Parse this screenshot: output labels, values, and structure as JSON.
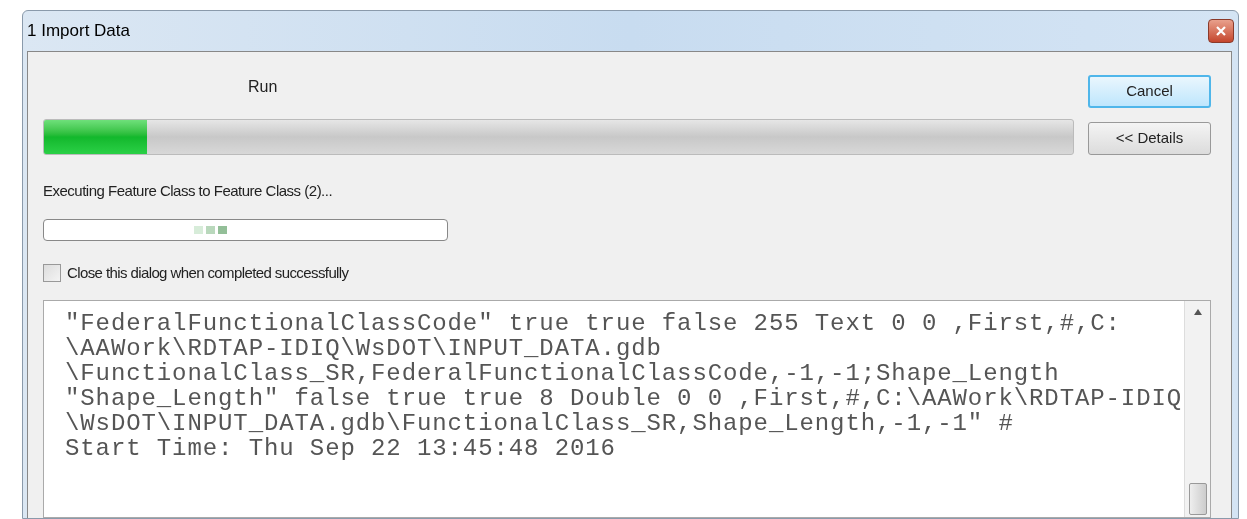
{
  "window": {
    "title": "1 Import Data"
  },
  "status": {
    "label": "Run",
    "level": 0.1
  },
  "buttons": [
    {
      "label": "Cancel",
      "focused": true
    },
    {
      "label": "<< Details",
      "focused": false
    }
  ],
  "step": {
    "label": "Executing Feature Class to Feature Class (2)..."
  },
  "close_when_done": {
    "label": "Close this dialog when completed successfully",
    "checked": false
  },
  "log": [
    "\"FederalFunctionalClassCode\" true true false 255 Text 0 0 ,First,#,C:",
    "\\AAWork\\RDTAP-IDIQ\\WsDOT\\INPUT_DATA.gdb",
    "\\FunctionalClass_SR,FederalFunctionalClassCode,-1,-1;Shape_Length",
    "\"Shape_Length\" false true true 8 Double 0 0 ,First,#,C:\\AAWork\\RDTAP-IDIQ",
    "\\WsDOT\\INPUT_DATA.gdb\\FunctionalClass_SR,Shape_Length,-1,-1\" #",
    "Start Time: Thu Sep 22 13:45:48 2016"
  ]
}
